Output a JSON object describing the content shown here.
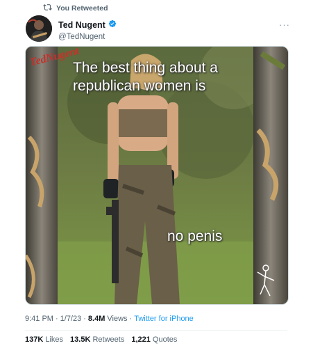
{
  "retweet": {
    "label": "You Retweeted",
    "icon": "retweet-icon"
  },
  "author": {
    "name": "Ted Nugent",
    "handle": "@TedNugent",
    "verified_icon": "verified-badge-icon",
    "accent": "#1d9bf0"
  },
  "more": {
    "label": "···"
  },
  "media": {
    "caption_top_line1": "The best thing about a",
    "caption_top_line2": "republican women is",
    "caption_bottom": "no penis",
    "logo_text": "TedNugent"
  },
  "meta": {
    "time": "9:41 PM",
    "sep1": "·",
    "date": "1/7/23",
    "sep2": "·",
    "views_count": "8.4M",
    "views_label": "Views",
    "sep3": "·",
    "source": "Twitter for iPhone"
  },
  "stats": {
    "likes_count": "137K",
    "likes_label": "Likes",
    "retweets_count": "13.5K",
    "retweets_label": "Retweets",
    "quotes_count": "1,221",
    "quotes_label": "Quotes"
  }
}
